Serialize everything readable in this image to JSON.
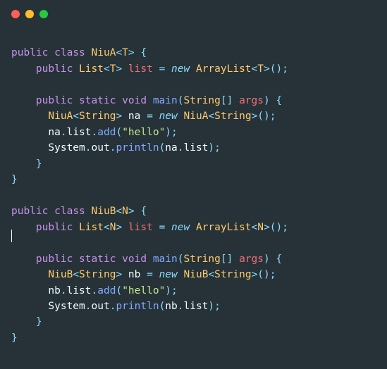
{
  "window": {
    "dot_red": "#ff5f56",
    "dot_yellow": "#ffbd2e",
    "dot_green": "#27c93f"
  },
  "code": {
    "kw_public": "public",
    "kw_class": "class",
    "kw_static": "static",
    "kw_void": "void",
    "kw_new": "new",
    "type_NiuA": "NiuA",
    "type_NiuB": "NiuB",
    "type_List": "List",
    "type_ArrayList": "ArrayList",
    "type_String": "String",
    "generic_T": "T",
    "generic_N": "N",
    "var_list": "list",
    "var_na": "na",
    "var_nb": "nb",
    "var_args": "args",
    "var_out": "out",
    "fn_main": "main",
    "fn_add": "add",
    "fn_println": "println",
    "obj_System": "System",
    "str_hello": "\"hello\"",
    "op_assign": "=",
    "lt": "<",
    "gt": ">",
    "lparen": "(",
    "rparen": ")",
    "lbrace": "{",
    "rbrace": "}",
    "lbracket": "[",
    "rbracket": "]",
    "semi": ";",
    "dot": "."
  }
}
